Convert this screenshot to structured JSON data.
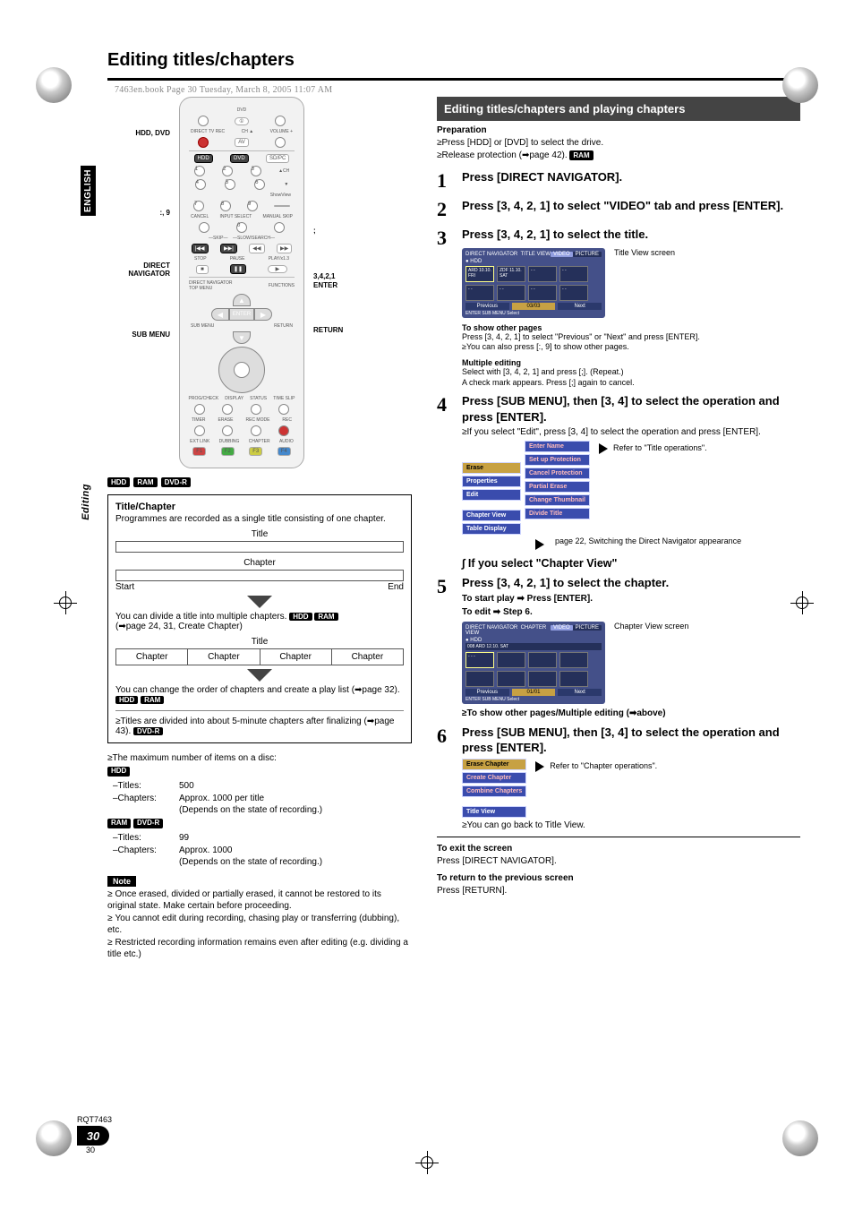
{
  "printmark": "7463en.book  Page 30  Tuesday, March 8, 2005  11:07 AM",
  "page_title": "Editing titles/chapters",
  "side_tab": "ENGLISH",
  "side_tab2": "Editing",
  "remote_labels_left": {
    "hdd_dvd": "HDD, DVD",
    "skip": ":, 9",
    "direct_nav": "DIRECT\nNAVIGATOR",
    "sub_menu": "SUB MENU"
  },
  "remote_labels_right": {
    "pause": ";",
    "dir_enter": "3,4,2,1\nENTER",
    "return": "RETURN"
  },
  "chips_row": [
    "HDD",
    "RAM",
    "DVD-R"
  ],
  "panel": {
    "head": "Title/Chapter",
    "desc": "Programmes are recorded as a single title consisting of one chapter.",
    "title_cap": "Title",
    "chapter_cap": "Chapter",
    "start": "Start",
    "end": "End",
    "line1a": "You can divide a title into multiple chapters. ",
    "line1_chips": [
      "HDD",
      "RAM"
    ],
    "line1b": "(➡page 24, 31, Create Chapter)",
    "ch": "Chapter",
    "line2": "You can change the order of chapters and create a play list (➡page 32). ",
    "line2_chips": [
      "HDD",
      "RAM"
    ],
    "line3": "≥Titles are divided into about 5-minute chapters after finalizing (➡page 43). ",
    "line3_chip": "DVD-R"
  },
  "maxitems": {
    "lead": "≥The maximum number of items on a disc:",
    "hdd_chip": "HDD",
    "titles": "–Titles:",
    "titles_v": "500",
    "chaps": "–Chapters:",
    "chaps_v": "Approx. 1000 per title",
    "chaps_v2": "(Depends on the state of recording.)",
    "ram_chips": [
      "RAM",
      "DVD-R"
    ],
    "titles2": "–Titles:",
    "titles2_v": "99",
    "chaps2": "–Chapters:",
    "chaps2_v": "Approx. 1000",
    "chaps2_v2": "(Depends on the state of recording.)"
  },
  "note_label": "Note",
  "notes": [
    "Once erased, divided or partially erased, it cannot be restored to its original state. Make certain before proceeding.",
    "You cannot edit during recording, chasing play or transferring (dubbing), etc.",
    "Restricted recording information remains even after editing (e.g. dividing a title etc.)"
  ],
  "section_bar": "Editing titles/chapters and playing chapters",
  "prep_head": "Preparation",
  "prep_lines": [
    "≥Press [HDD] or [DVD] to select the drive.",
    "≥Release protection (➡page 42). "
  ],
  "prep_chip": "RAM",
  "steps": {
    "s1": "Press [DIRECT NAVIGATOR].",
    "s2": "Press [3, 4, 2, 1] to select \"VIDEO\" tab and press [ENTER].",
    "s3": "Press [3, 4, 2, 1] to select the title.",
    "s3_caption": "Title View screen",
    "s3_underhead1": "To show other pages",
    "s3_under1": "Press [3, 4, 2, 1] to select \"Previous\" or \"Next\" and press [ENTER].",
    "s3_under2": "≥You can also press [:, 9] to show other pages.",
    "s3_underhead2": "Multiple editing",
    "s3_under3": "Select with [3, 4, 2, 1] and press [;]. (Repeat.)",
    "s3_under4": "A check mark appears. Press [;] again to cancel.",
    "s4": "Press [SUB MENU], then [3, 4] to select the operation and press [ENTER].",
    "s4_sub": "≥If you select \"Edit\", press [3, 4] to select the operation and press [ENTER].",
    "s4_menu_left": [
      "Erase",
      "Properties",
      "Edit",
      "Chapter View",
      "Table Display"
    ],
    "s4_menu_right": [
      "Enter Name",
      "Set up Protection",
      "Cancel Protection",
      "Partial Erase",
      "Change Thumbnail",
      "Divide Title"
    ],
    "s4_ref": "Refer to \"Title operations\".",
    "s4_switch": "page 22, Switching the Direct Navigator appearance",
    "s4_if": "∫ If you select \"Chapter View\"",
    "s5": "Press [3, 4, 2, 1] to select the chapter.",
    "s5_sub1": "To start play ➡ Press [ENTER].",
    "s5_sub2": "To edit ➡ Step 6.",
    "s5_caption": "Chapter View screen",
    "s5_foot": "≥To show other pages/Multiple editing (➡above)",
    "s6": "Press [SUB MENU], then [3, 4] to select the operation and press [ENTER].",
    "s6_menu": [
      "Erase Chapter",
      "Create Chapter",
      "Combine Chapters",
      "Title View"
    ],
    "s6_ref": "Refer to \"Chapter operations\".",
    "s6_back": "≥You can go back to Title View."
  },
  "screenshots": {
    "title_view": {
      "title": "DIRECT NAVIGATOR",
      "mode": "TITLE VIEW",
      "drive": "HDD",
      "tabs": [
        "VIDEO",
        "PICTURE"
      ],
      "items": [
        "ARD 10.10. FRI",
        "ZDF 11.10. SAT",
        "- -",
        "- -",
        "- -",
        "- -",
        "- -",
        "- -"
      ],
      "nav": [
        "Previous",
        "03/03",
        "Next"
      ],
      "foot": "ENTER    SUB MENU    Select"
    },
    "chapter_view": {
      "title": "DIRECT NAVIGATOR",
      "mode": "CHAPTER VIEW",
      "drive": "HDD",
      "tabs": [
        "VIDEO",
        "PICTURE"
      ],
      "date": "008 ARD 12.10. SAT",
      "items": [
        "- - -",
        "- - -",
        "- - -",
        "- - -",
        "- - -",
        "- - -",
        "- - -",
        "- - -"
      ],
      "nav": [
        "Previous",
        "01/01",
        "Next"
      ],
      "foot": "ENTER    SUB MENU    Select"
    }
  },
  "exit": {
    "h1": "To exit the screen",
    "t1": "Press [DIRECT NAVIGATOR].",
    "h2": "To return to the previous screen",
    "t2": "Press [RETURN]."
  },
  "footer": {
    "rqt": "RQT7463",
    "pg": "30",
    "n": "30"
  }
}
